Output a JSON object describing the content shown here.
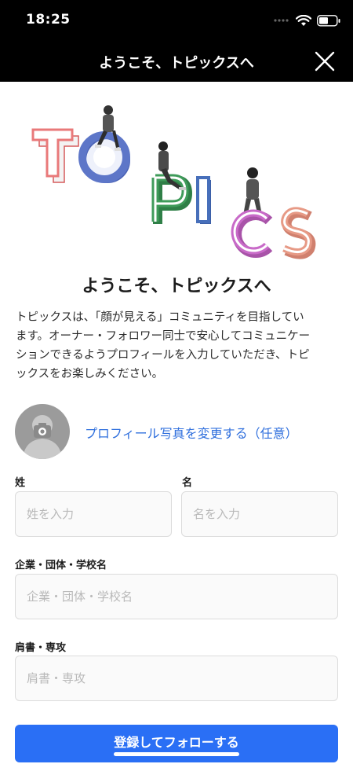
{
  "status_bar": {
    "time": "18:25",
    "signal_icon": "cellular-dots-icon",
    "wifi_icon": "wifi-icon",
    "battery_icon": "battery-icon"
  },
  "nav": {
    "title": "ようこそ、トピックスへ",
    "close_icon": "close-icon"
  },
  "hero": {
    "letters": [
      "T",
      "O",
      "P",
      "I",
      "C",
      "S"
    ],
    "colors": {
      "T": "#e9797a",
      "O": "#5d76c8",
      "P": "#3f9b5a",
      "I": "#476fba",
      "C": "#c86ac8",
      "S": "#e79a86"
    }
  },
  "welcome": {
    "heading": "ようこそ、トピックスへ",
    "lines": [
      "トピックスは、「顔が見える」コミュニティを目指してい",
      "ます。オーナー・フォロワー同士で安心してコミュニケー",
      "ションできるようプロフィールを入力していただき、トピ",
      "ックスをお楽しみください。"
    ]
  },
  "profile_photo": {
    "avatar_icon": "camera-icon",
    "link_label": "プロフィール写真を変更する（任意）"
  },
  "form": {
    "last_name_label": "姓",
    "last_name_placeholder": "姓を入力",
    "first_name_label": "名",
    "first_name_placeholder": "名を入力",
    "org_label": "企業・団体・学校名",
    "org_placeholder": "企業・団体・学校名",
    "title_label": "肩書・専攻",
    "title_placeholder": "肩書・専攻"
  },
  "submit": {
    "label": "登録してフォローする",
    "color": "#2a6ff5"
  },
  "colors": {
    "accent": "#2a6ff5",
    "link": "#2f6fdd",
    "header_bg": "#000000"
  }
}
